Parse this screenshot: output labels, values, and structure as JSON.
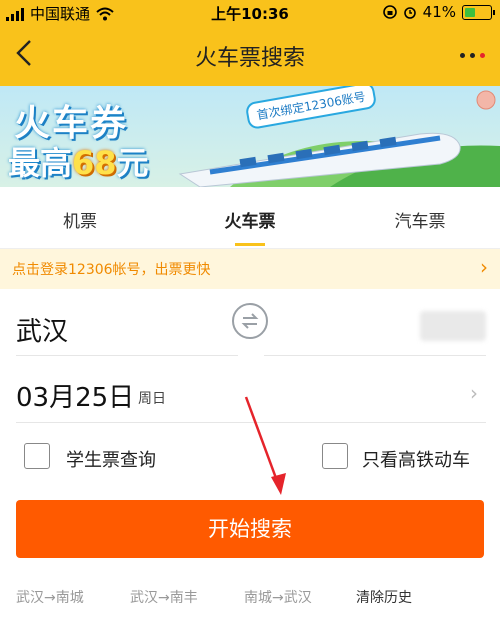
{
  "status_bar": {
    "carrier": "中国联通",
    "time": "上午10:36",
    "battery": "41%",
    "battery_level": 0.41
  },
  "header": {
    "title": "火车票搜索",
    "back_icon": "back-chevron-icon",
    "more_icon": "more-dots-icon"
  },
  "banner": {
    "line1": "火车券",
    "line2_prefix": "最高",
    "line2_amount": "68",
    "line2_suffix": "元",
    "tag": "首次绑定12306账号"
  },
  "tabs": [
    {
      "label": "机票"
    },
    {
      "label": "火车票",
      "active": true
    },
    {
      "label": "汽车票"
    }
  ],
  "notice": {
    "text": "点击登录12306帐号，出票更快"
  },
  "form": {
    "from_city": "武汉",
    "date": "03月25日",
    "weekday": "周日",
    "student_label": "学生票查询",
    "highspeed_label": "只看高铁动车",
    "search_label": "开始搜索"
  },
  "history": [
    {
      "label": "武汉→南城"
    },
    {
      "label": "武汉→南丰"
    },
    {
      "label": "南城→武汉"
    }
  ],
  "clear_history_label": "清除历史",
  "colors": {
    "accent": "#f9c21b",
    "search_button": "#ff5a00",
    "notice_text": "#f08a00"
  }
}
